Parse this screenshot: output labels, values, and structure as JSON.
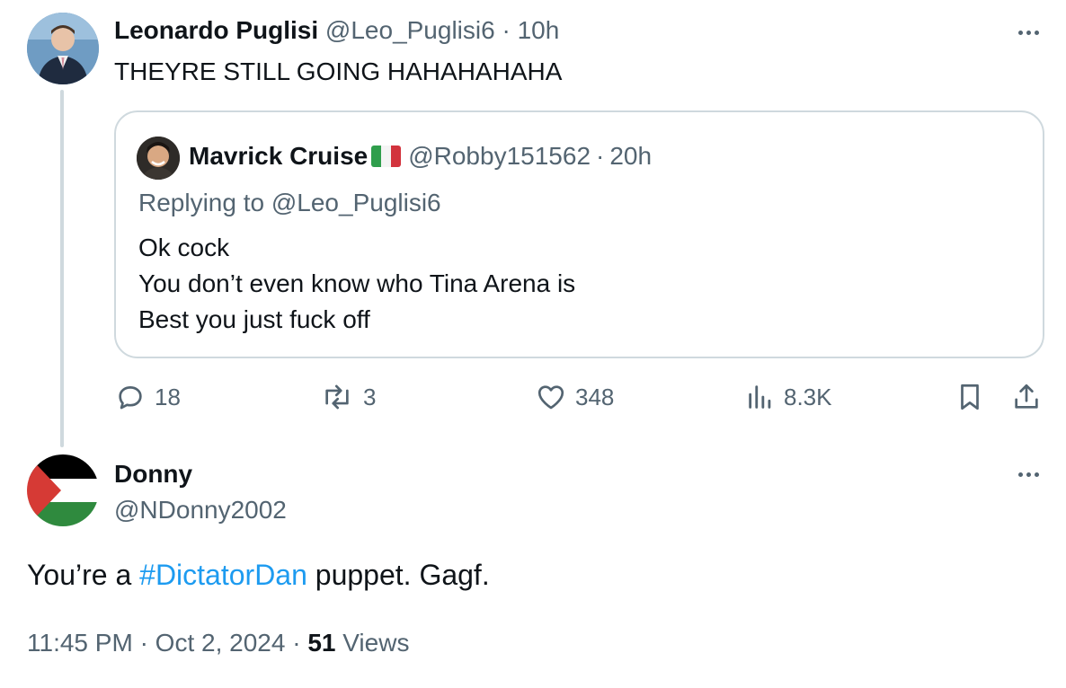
{
  "main_tweet": {
    "author_name": "Leonardo Puglisi",
    "author_handle": "@Leo_Puglisi6",
    "separator": "·",
    "time_ago": "10h",
    "text": "THEYRE STILL GOING HAHAHAHAHA"
  },
  "quoted_tweet": {
    "author_name": "Mavrick Cruise",
    "author_handle": "@Robby151562",
    "separator": "·",
    "time_ago": "20h",
    "replying_to": "Replying to @Leo_Puglisi6",
    "lines": [
      "Ok cock",
      "You don’t even know who Tina Arena is",
      "Best you just fuck off"
    ]
  },
  "actions": {
    "replies": "18",
    "reposts": "3",
    "likes": "348",
    "views": "8.3K"
  },
  "reply_tweet": {
    "author_name": "Donny",
    "author_handle": "@NDonny2002",
    "text_before": "You’re a ",
    "hashtag": "#DictatorDan",
    "text_after": " puppet. Gagf.",
    "time": "11:45 PM",
    "date": "Oct 2, 2024",
    "separator": "·",
    "views_count": "51",
    "views_label": "Views"
  },
  "colors": {
    "accent": "#1d9bf0",
    "muted": "#536471",
    "border": "#cfd9de",
    "text": "#0f1419"
  },
  "icons": [
    "more-icon",
    "reply-icon",
    "repost-icon",
    "like-icon",
    "views-icon",
    "bookmark-icon",
    "share-icon"
  ]
}
